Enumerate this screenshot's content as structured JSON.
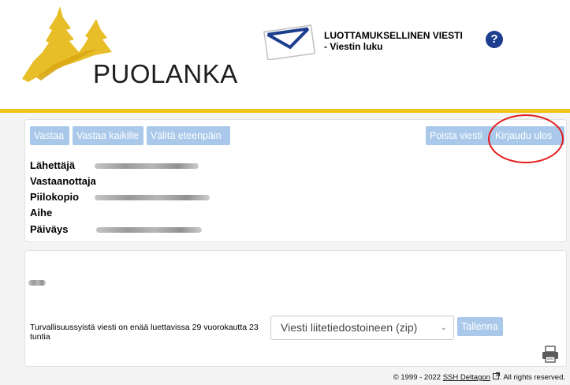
{
  "header": {
    "logo_text": "PUOLANKA",
    "title_line1": "LUOTTAMUKSELLINEN VIESTI",
    "title_line2": "- Viestin luku",
    "help_icon_label": "?"
  },
  "toolbar": {
    "reply": "Vastaa",
    "reply_all": "Vastaa kaikille",
    "forward": "Välitä eteenpäin",
    "delete": "Poista viesti",
    "logout": "Kirjaudu ulos"
  },
  "fields": {
    "sender": "Lähettäjä",
    "recipient": "Vastaanottaja",
    "bcc": "Piilokopio",
    "subject": "Aihe",
    "date": "Päiväys"
  },
  "download": {
    "retention_text": "Turvallisuussyistä viesti on enää luettavissa 29 vuorokautta 23 tuntia",
    "selected_format": "Viesti liitetiedostoineen (zip)",
    "save": "Tallenna"
  },
  "footer": {
    "copyright": "© 1999 - 2022",
    "link": "SSH Deltagon",
    "rights": "All rights reserved."
  },
  "colors": {
    "accent_bar": "#f0c419",
    "button": "#a9c8ea",
    "help": "#1d3d8f",
    "highlight": "#e41b1b"
  },
  "icons": [
    "puolanka-logo-icon",
    "envelope-icon",
    "help-icon",
    "external-link-icon",
    "printer-icon",
    "chevron-down-icon"
  ]
}
